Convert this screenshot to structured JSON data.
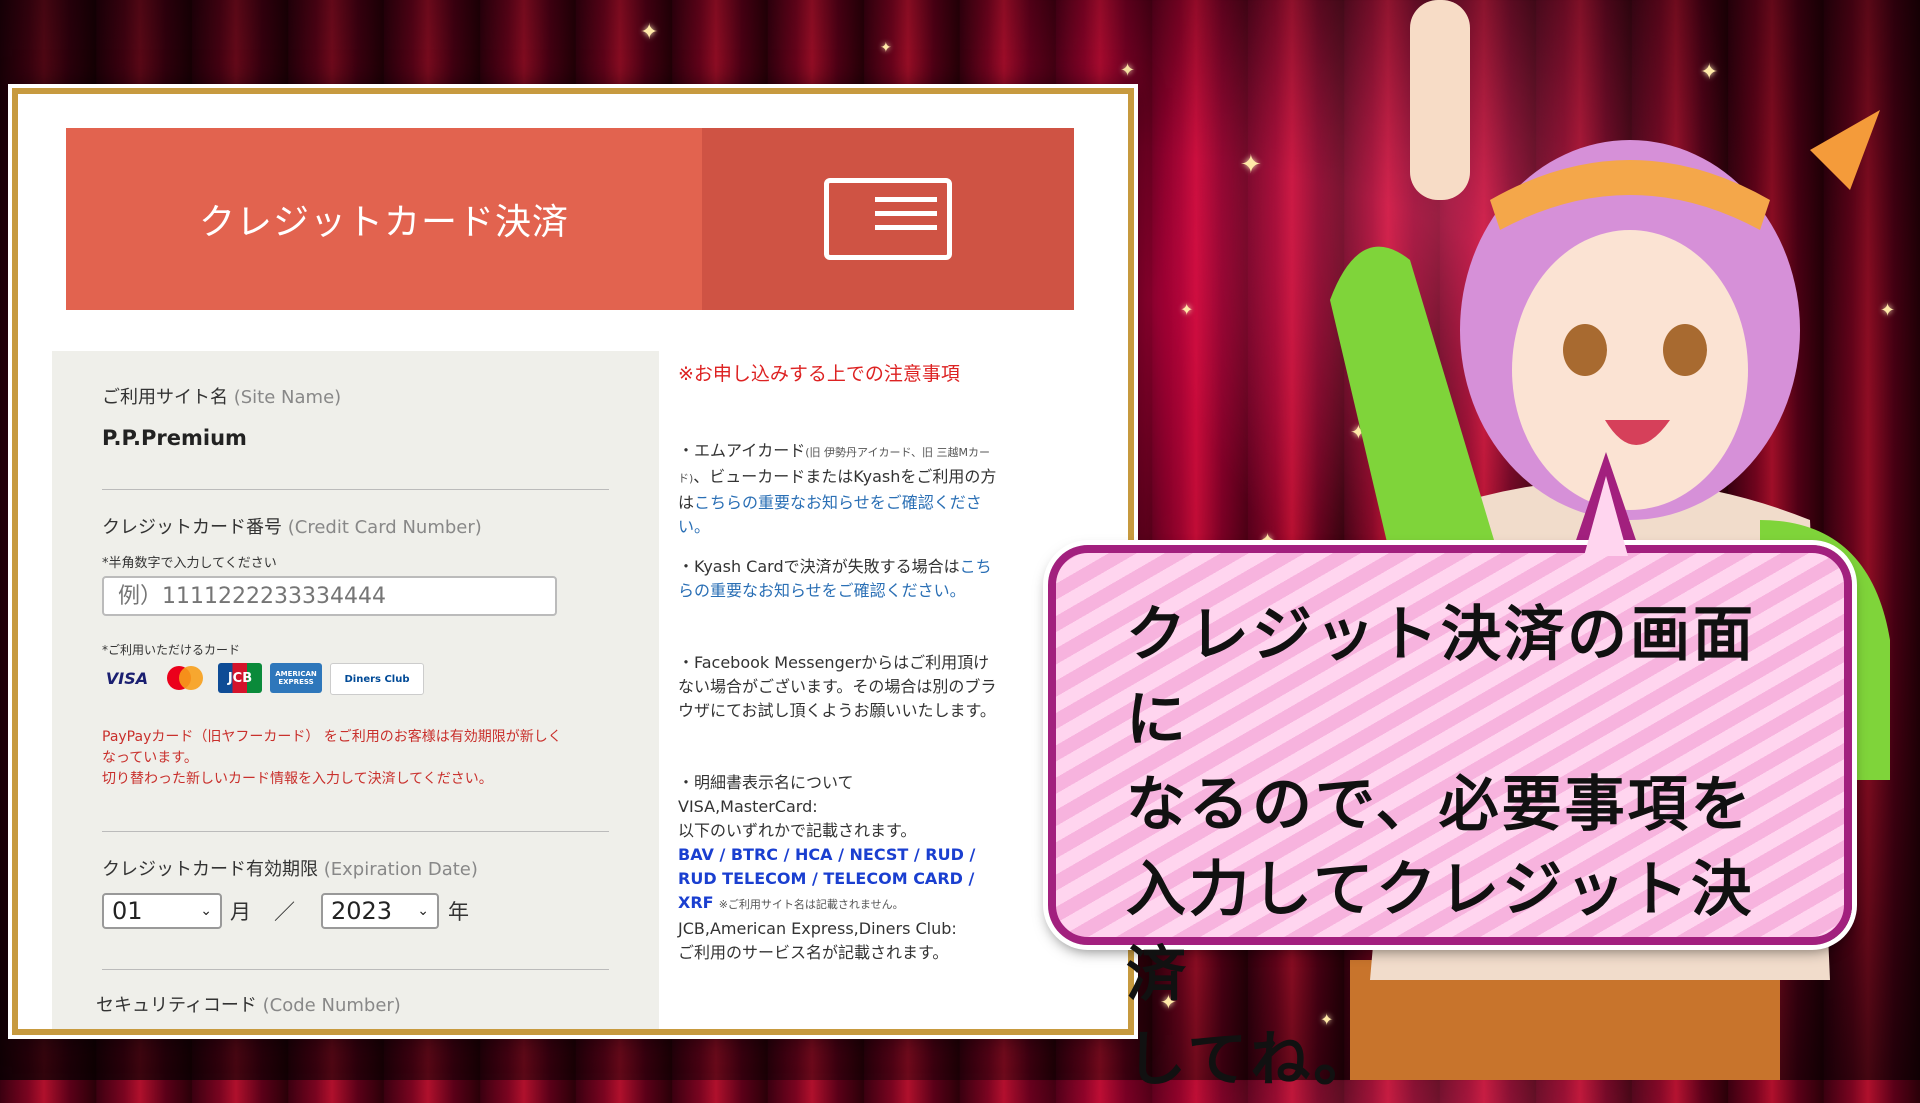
{
  "banner": {
    "title": "クレジットカード決済",
    "icon": "credit-card-icon"
  },
  "form": {
    "site_label": "ご利用サイト名",
    "site_label_en": "(Site Name)",
    "site_value": "P.P.Premium",
    "card_label": "クレジットカード番号",
    "card_label_en": "(Credit Card Number)",
    "card_hint": "*半角数字で入力してください",
    "card_placeholder": "例）1111222233334444",
    "brands_label": "*ご利用いただけるカード",
    "brands": [
      "VISA",
      "mastercard",
      "JCB",
      "AMERICAN EXPRESS",
      "Diners Club"
    ],
    "paypay_warning_1": "PayPayカード（旧ヤフーカード） をご利用のお客様は有効期限が新しく",
    "paypay_warning_2": "なっています。",
    "paypay_warning_3": "切り替わった新しいカード情報を入力して決済してください。",
    "expiry_label": "クレジットカード有効期限",
    "expiry_label_en": "(Expiration Date)",
    "month_value": "01",
    "month_unit": "月",
    "separator": "／",
    "year_value": "2023",
    "year_unit": "年",
    "security_label": "セキュリティコード",
    "security_label_en": "(Code Number)"
  },
  "notes": {
    "heading": "※お申し込みする上での注意事項",
    "p1_a": "・エムアイカード",
    "p1_b": "(旧 伊勢丹アイカード、旧 三越Mカード)",
    "p1_c": "、ビューカードまたはKyashをご利用の方は",
    "p1_link": "こちらの重要なお知らせをご確認ください。",
    "p2_a": "・Kyash Cardで決済が失敗する場合は",
    "p2_link": "こちらの重要なお知らせをご確認ください。",
    "p3": "・Facebook Messengerからはご利用頂けない場合がございます。その場合は別のブラウザにてお試し頂くようお願いいたします。",
    "p4_a": "・明細書表示名について",
    "p4_b": "VISA,MasterCard:",
    "p4_c": "以下のいずれかで記載されます。",
    "p4_names": "BAV / BTRC / HCA / NECST / RUD / RUD TELECOM / TELECOM CARD / XRF",
    "p4_tiny": "※ご利用サイト名は記載されません。",
    "p4_d": "JCB,American Express,Diners Club:",
    "p4_e": "ご利用のサービス名が記載されます。"
  },
  "bubble": {
    "line1": "クレジット決済の画面に",
    "line2": "なるので、必要事項を",
    "line3": "入力してクレジット決済",
    "line4": "してね。"
  },
  "colors": {
    "banner_left": "#e2634f",
    "banner_right": "#cf5344",
    "bubble_border": "#a2207e",
    "link": "#2a6fb5",
    "warning": "#c9302c"
  }
}
